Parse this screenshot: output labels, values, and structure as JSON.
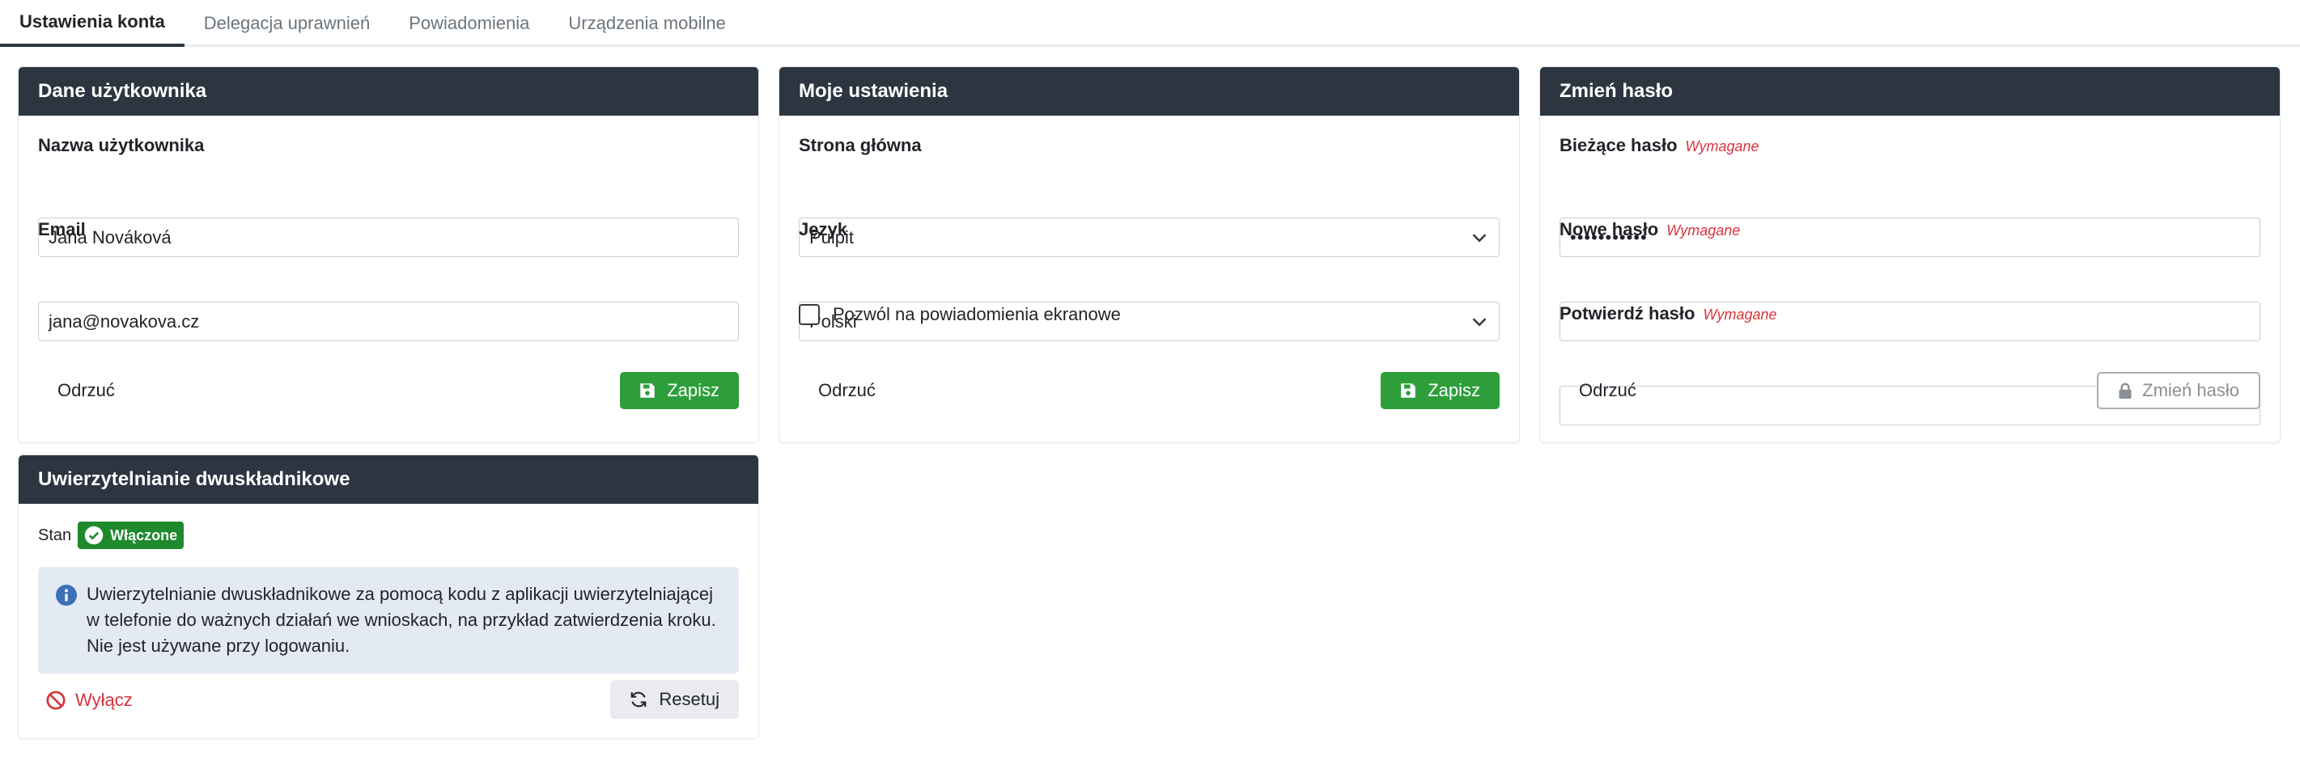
{
  "tabs": [
    {
      "label": "Ustawienia konta",
      "active": true
    },
    {
      "label": "Delegacja uprawnień",
      "active": false
    },
    {
      "label": "Powiadomienia",
      "active": false
    },
    {
      "label": "Urządzenia mobilne",
      "active": false
    }
  ],
  "user_card": {
    "title": "Dane użytkownika",
    "username_label": "Nazwa użytkownika",
    "username_value": "Jana Nováková",
    "email_label": "Email",
    "email_value": "jana@novakova.cz",
    "discard_label": "Odrzuć",
    "save_label": "Zapisz"
  },
  "settings_card": {
    "title": "Moje ustawienia",
    "homepage_label": "Strona główna",
    "homepage_value": "Pulpit",
    "language_label": "Język",
    "language_value": "Polski",
    "notifications_checkbox_label": "Pozwól na powiadomienia ekranowe",
    "notifications_checked": false,
    "discard_label": "Odrzuć",
    "save_label": "Zapisz"
  },
  "password_card": {
    "title": "Zmień hasło",
    "current_label": "Bieżące hasło",
    "current_value": "•••••••••••",
    "new_label": "Nowe hasło",
    "new_value": "",
    "confirm_label": "Potwierdź hasło",
    "confirm_value": "",
    "required_text": "Wymagane",
    "discard_label": "Odrzuć",
    "change_label": "Zmień hasło"
  },
  "twofa_card": {
    "title": "Uwierzytelnianie dwuskładnikowe",
    "status_label": "Stan",
    "status_badge": "Włączone",
    "info_lines": [
      "Uwierzytelnianie dwuskładnikowe za pomocą kodu z aplikacji uwierzytelniającej",
      "w telefonie do ważnych działań we wnioskach, na przykład zatwierdzenia kroku.",
      "Nie jest używane przy logowaniu."
    ],
    "disable_label": "Wyłącz",
    "reset_label": "Resetuj"
  },
  "colors": {
    "header_bg": "#2d3640",
    "success": "#2e9e3b",
    "badge": "#1e8a2c",
    "danger": "#d6333b",
    "info_bg": "#e3eaf3",
    "info_icon": "#3b6fb6"
  },
  "icons": {
    "save": "floppy-disk-icon",
    "lock": "lock-icon",
    "check": "check-circle-icon",
    "info": "info-circle-icon",
    "ban": "ban-icon",
    "reset": "refresh-icon",
    "chevron": "chevron-down-icon"
  }
}
